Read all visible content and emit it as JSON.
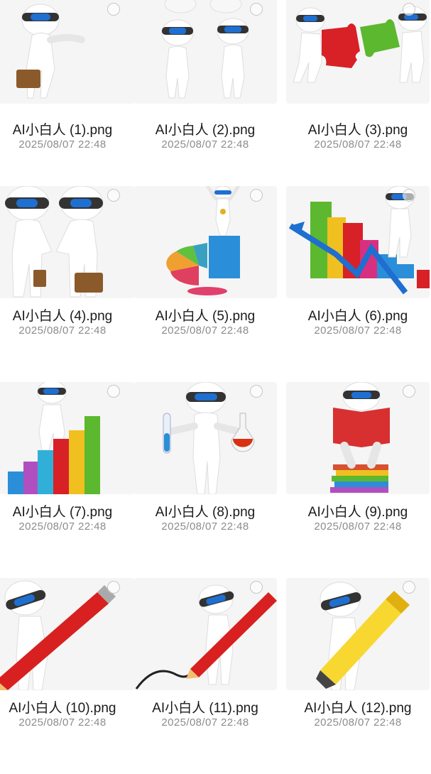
{
  "files": [
    {
      "name": "AI小白人 (1).png",
      "date": "2025/08/07 22:48",
      "scene": "man-with-briefcase"
    },
    {
      "name": "AI小白人 (2).png",
      "date": "2025/08/07 22:48",
      "scene": "two-men-talking"
    },
    {
      "name": "AI小白人 (3).png",
      "date": "2025/08/07 22:48",
      "scene": "puzzle-pieces"
    },
    {
      "name": "AI小白人 (4).png",
      "date": "2025/08/07 22:48",
      "scene": "handshake"
    },
    {
      "name": "AI小白人 (5).png",
      "date": "2025/08/07 22:48",
      "scene": "winner-on-pie-chart"
    },
    {
      "name": "AI小白人 (6).png",
      "date": "2025/08/07 22:48",
      "scene": "bar-chart-arrow"
    },
    {
      "name": "AI小白人 (7).png",
      "date": "2025/08/07 22:48",
      "scene": "climbing-bars"
    },
    {
      "name": "AI小白人 (8).png",
      "date": "2025/08/07 22:48",
      "scene": "test-tube-flask"
    },
    {
      "name": "AI小白人 (9).png",
      "date": "2025/08/07 22:48",
      "scene": "reading-on-books"
    },
    {
      "name": "AI小白人 (10).png",
      "date": "2025/08/07 22:48",
      "scene": "carrying-pencil"
    },
    {
      "name": "AI小白人 (11).png",
      "date": "2025/08/07 22:48",
      "scene": "drawing-with-pencil"
    },
    {
      "name": "AI小白人 (12).png",
      "date": "2025/08/07 22:48",
      "scene": "carrying-highlighter"
    }
  ],
  "colors": {
    "visor": "#1e6fd0",
    "thumb_bg": "#f5f5f5",
    "name_text": "#1a1a1a",
    "date_text": "#8c8c8c"
  }
}
